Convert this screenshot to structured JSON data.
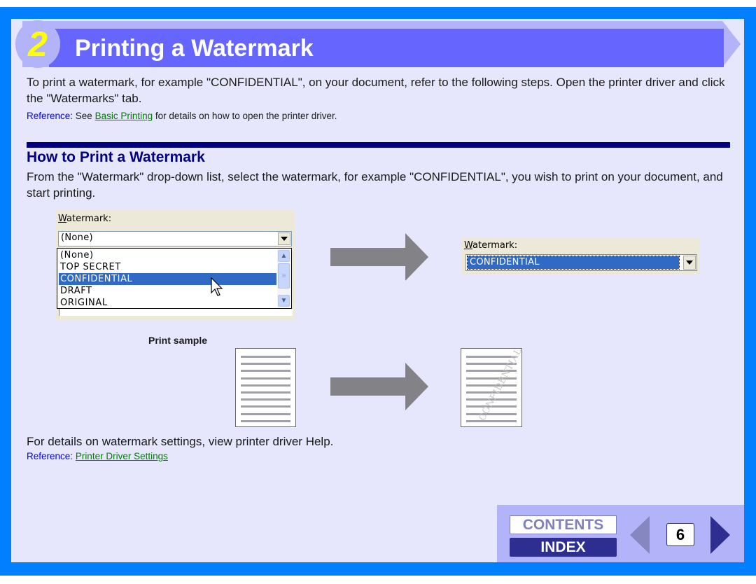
{
  "header": {
    "step_number": "2",
    "title": "Printing a Watermark"
  },
  "intro": {
    "paragraph": "To print a watermark, for example \"CONFIDENTIAL\", on your document, refer to the following steps. Open the printer driver and click the \"Watermarks\" tab.",
    "reference_label": "Reference:",
    "reference_pre": " See ",
    "reference_link": "Basic Printing",
    "reference_post": " for details on how to open the printer driver."
  },
  "section": {
    "heading": "How to Print a Watermark",
    "paragraph": "From the \"Watermark\" drop-down list, select the watermark, for example \"CONFIDENTIAL\", you wish to print on your document, and start printing."
  },
  "dropdown_before": {
    "label_accel": "W",
    "label_rest": "atermark:",
    "selected_value": "(None)",
    "options": [
      "(None)",
      "TOP SECRET",
      "CONFIDENTIAL",
      "DRAFT",
      "ORIGINAL"
    ],
    "highlighted_option": "CONFIDENTIAL"
  },
  "dropdown_after": {
    "label_accel": "W",
    "label_rest": "atermark:",
    "selected_value": "CONFIDENTIAL"
  },
  "print_sample": {
    "label": "Print sample",
    "watermark_text": "CONFIDENTIAL"
  },
  "footer_text": {
    "paragraph": "For details on watermark settings, view printer driver Help.",
    "reference_label": "Reference:",
    "reference_link": "Printer Driver Settings"
  },
  "nav": {
    "contents_label": "CONTENTS",
    "index_label": "INDEX",
    "page_number": "6"
  },
  "colors": {
    "frame_blue": "#0080ff",
    "panel_bg": "#e6e6fc",
    "banner": "#6666ff",
    "banner_light": "#b3b3fa",
    "step_number": "#ffff00",
    "heading_navy": "#000080",
    "reference_blue": "#0000ff",
    "link_green": "#008000",
    "selection_blue": "#316ac5"
  }
}
